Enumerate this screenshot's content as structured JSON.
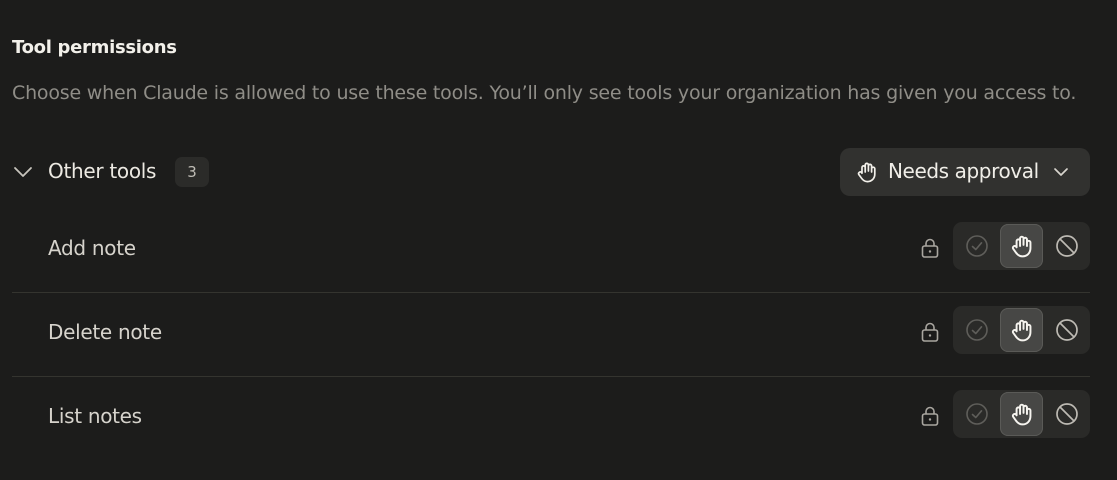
{
  "section": {
    "title": "Tool permissions",
    "description": "Choose when Claude is allowed to use these tools. You’ll only see tools your organization has given you access to."
  },
  "group": {
    "label": "Other tools",
    "count": "3",
    "policy_label": "Needs approval"
  },
  "tools": [
    {
      "name": "Add note",
      "mode": "needs-approval"
    },
    {
      "name": "Delete note",
      "mode": "needs-approval"
    },
    {
      "name": "List notes",
      "mode": "needs-approval"
    }
  ],
  "icons": {
    "collapse": "chevron-down-icon",
    "policy": "hand-icon",
    "lock": "lock-icon",
    "allow": "check-circle-icon",
    "approval": "hand-icon",
    "block": "block-icon"
  },
  "colors": {
    "background": "#1c1c1b",
    "dropdown": "#31312f",
    "selected_option": "#474745"
  }
}
